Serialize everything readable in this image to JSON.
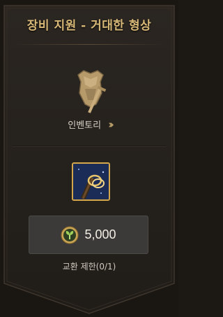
{
  "title": "장비 지원 - 거대한 형상",
  "emblem_icon": "armor-sword-icon",
  "inventory": {
    "label": "인벤토리",
    "icon": "double-chevron-right-icon"
  },
  "item": {
    "icon": "bracelet-item-icon",
    "border_color": "#d4a84a"
  },
  "price": {
    "icon": "leaf-coin-icon",
    "amount": "5,000"
  },
  "exchange_limit": "교환 제한(0/1)",
  "colors": {
    "title": "#d8b877",
    "panel": "#26221e",
    "accent": "#b49a67"
  }
}
